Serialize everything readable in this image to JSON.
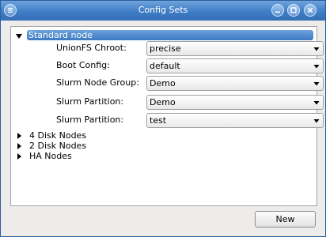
{
  "window": {
    "title": "Config Sets",
    "menu_icon": "window-menu-icon",
    "minimize_icon": "minimize-icon",
    "maximize_icon": "maximize-icon",
    "close_icon": "close-icon"
  },
  "tree": {
    "expanded_node": {
      "label": "Standard node",
      "fields": [
        {
          "label": "UnionFS Chroot:",
          "value": "precise"
        },
        {
          "label": "Boot Config:",
          "value": "default"
        },
        {
          "label": "Slurm Node Group:",
          "value": "Demo"
        },
        {
          "label": "Slurm Partition:",
          "value": "Demo"
        },
        {
          "label": "Slurm Partition:",
          "value": "test"
        }
      ]
    },
    "collapsed_nodes": [
      {
        "label": "4 Disk Nodes"
      },
      {
        "label": "2 Disk Nodes"
      },
      {
        "label": "HA Nodes"
      }
    ]
  },
  "footer": {
    "new_button": "New"
  },
  "colors": {
    "titlebar": "#3f7dc5",
    "selection": "#4a86cc"
  }
}
